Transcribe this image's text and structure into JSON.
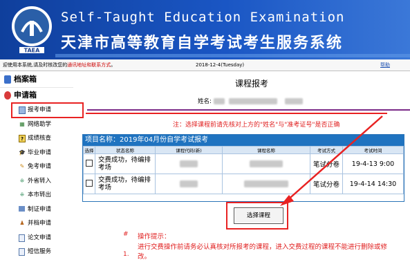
{
  "header": {
    "title_en": "Self-Taught Education Examination",
    "title_cn": "天津市高等教育自学考试考生服务系统",
    "logo_text": "TAEA"
  },
  "infobar": {
    "message_prefix": "迎使用本系统,请及时核改您的",
    "message_link": "通讯地址和联系方式",
    "message_suffix": "。",
    "date": "2018-12-4(Tuesday)",
    "help": "帮助"
  },
  "sidebar": {
    "groups": [
      {
        "label": "档案箱"
      },
      {
        "label": "申请箱"
      }
    ],
    "items": [
      {
        "label": "报考申请",
        "icon": "form-icon"
      },
      {
        "label": "网络助学",
        "icon": "network-icon"
      },
      {
        "label": "成绩核查",
        "icon": "question-icon"
      },
      {
        "label": "毕业申请",
        "icon": "graduation-cap-icon"
      },
      {
        "label": "免考申请",
        "icon": "pencil-icon"
      },
      {
        "label": "外省转入",
        "icon": "transfer-in-icon"
      },
      {
        "label": "本市转出",
        "icon": "transfer-out-icon"
      },
      {
        "label": "制证申请",
        "icon": "certificate-icon"
      },
      {
        "label": "并档申请",
        "icon": "merge-icon"
      },
      {
        "label": "论文申请",
        "icon": "document-icon"
      },
      {
        "label": "短信服务",
        "icon": "sms-icon"
      }
    ]
  },
  "main": {
    "heading": "课程报考",
    "name_label": "姓名:",
    "note": "注：选择课程前请先核对上方的\"姓名\"与\"准考证号\"是否正确",
    "project_title": "项目名称：2019年04月份自学考试报考",
    "columns": [
      "选择",
      "状态名称",
      "课程代码(新)",
      "课程名称",
      "考试方式",
      "考试时间"
    ],
    "rows": [
      {
        "status": "交费成功，待编排考场",
        "method": "笔试分卷",
        "time": "19-4-13 9:00"
      },
      {
        "status": "交费成功，待编排考场",
        "method": "笔试分卷",
        "time": "19-4-14 14:30"
      }
    ],
    "select_button": "选择课程",
    "tips": {
      "marker": "#",
      "title": "操作提示：",
      "items": [
        {
          "num": "1.",
          "text": "进行交费操作前请务必认真核对所报考的课程，进入交费过程的课程不能进行删除或修改。"
        }
      ]
    }
  },
  "colors": {
    "banner": "#1a56c4",
    "highlight": "#e82222",
    "table_header": "#1f73c0",
    "divider": "#7a2a88"
  }
}
